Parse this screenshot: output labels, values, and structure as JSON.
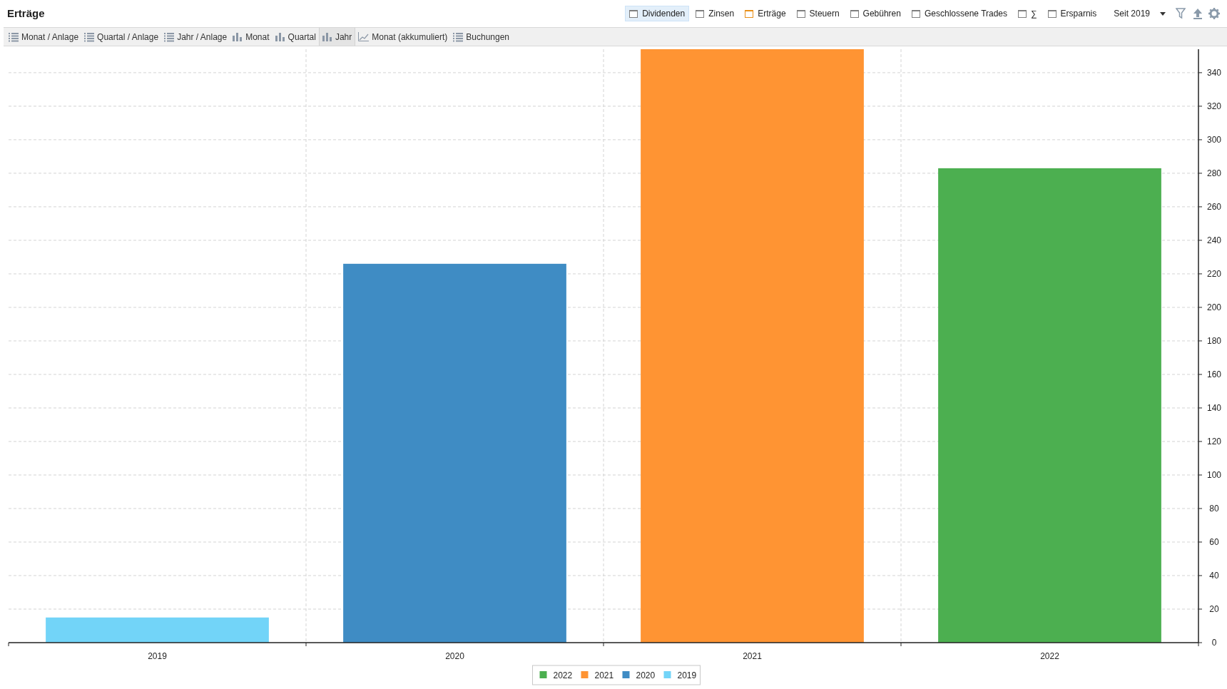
{
  "title": "Erträge",
  "filters": [
    {
      "label": "Dividenden",
      "selected": true,
      "color": "#808080"
    },
    {
      "label": "Zinsen",
      "selected": false,
      "color": "#808080"
    },
    {
      "label": "Erträge",
      "selected": false,
      "color": "#e8901a"
    },
    {
      "label": "Steuern",
      "selected": false,
      "color": "#808080"
    },
    {
      "label": "Gebühren",
      "selected": false,
      "color": "#808080"
    },
    {
      "label": "Geschlossene Trades",
      "selected": false,
      "color": "#808080"
    },
    {
      "label": "∑",
      "selected": false,
      "color": "#808080"
    },
    {
      "label": "Ersparnis",
      "selected": false,
      "color": "#808080"
    }
  ],
  "period": "Seit 2019",
  "views": [
    {
      "label": "Monat / Anlage",
      "kind": "list",
      "selected": false
    },
    {
      "label": "Quartal / Anlage",
      "kind": "list",
      "selected": false
    },
    {
      "label": "Jahr / Anlage",
      "kind": "list",
      "selected": false
    },
    {
      "label": "Monat",
      "kind": "bar",
      "selected": false
    },
    {
      "label": "Quartal",
      "kind": "bar",
      "selected": false
    },
    {
      "label": "Jahr",
      "kind": "bar",
      "selected": true
    },
    {
      "label": "Monat (akkumuliert)",
      "kind": "line",
      "selected": false
    },
    {
      "label": "Buchungen",
      "kind": "list",
      "selected": false
    }
  ],
  "chart_data": {
    "type": "bar",
    "categories": [
      "2019",
      "2020",
      "2021",
      "2022"
    ],
    "grid": true,
    "legend": true,
    "series": [
      {
        "name": "2022",
        "color": "#4caf50",
        "values": [
          null,
          null,
          null,
          283
        ]
      },
      {
        "name": "2021",
        "color": "#ff9433",
        "values": [
          null,
          null,
          354,
          null
        ]
      },
      {
        "name": "2020",
        "color": "#3f8cc4",
        "values": [
          null,
          226,
          null,
          null
        ]
      },
      {
        "name": "2019",
        "color": "#72d4f8",
        "values": [
          15,
          null,
          null,
          null
        ]
      }
    ],
    "ylim": [
      0,
      354
    ],
    "yticks": [
      0,
      20,
      40,
      60,
      80,
      100,
      120,
      140,
      160,
      180,
      200,
      220,
      240,
      260,
      280,
      300,
      320,
      340
    ]
  }
}
